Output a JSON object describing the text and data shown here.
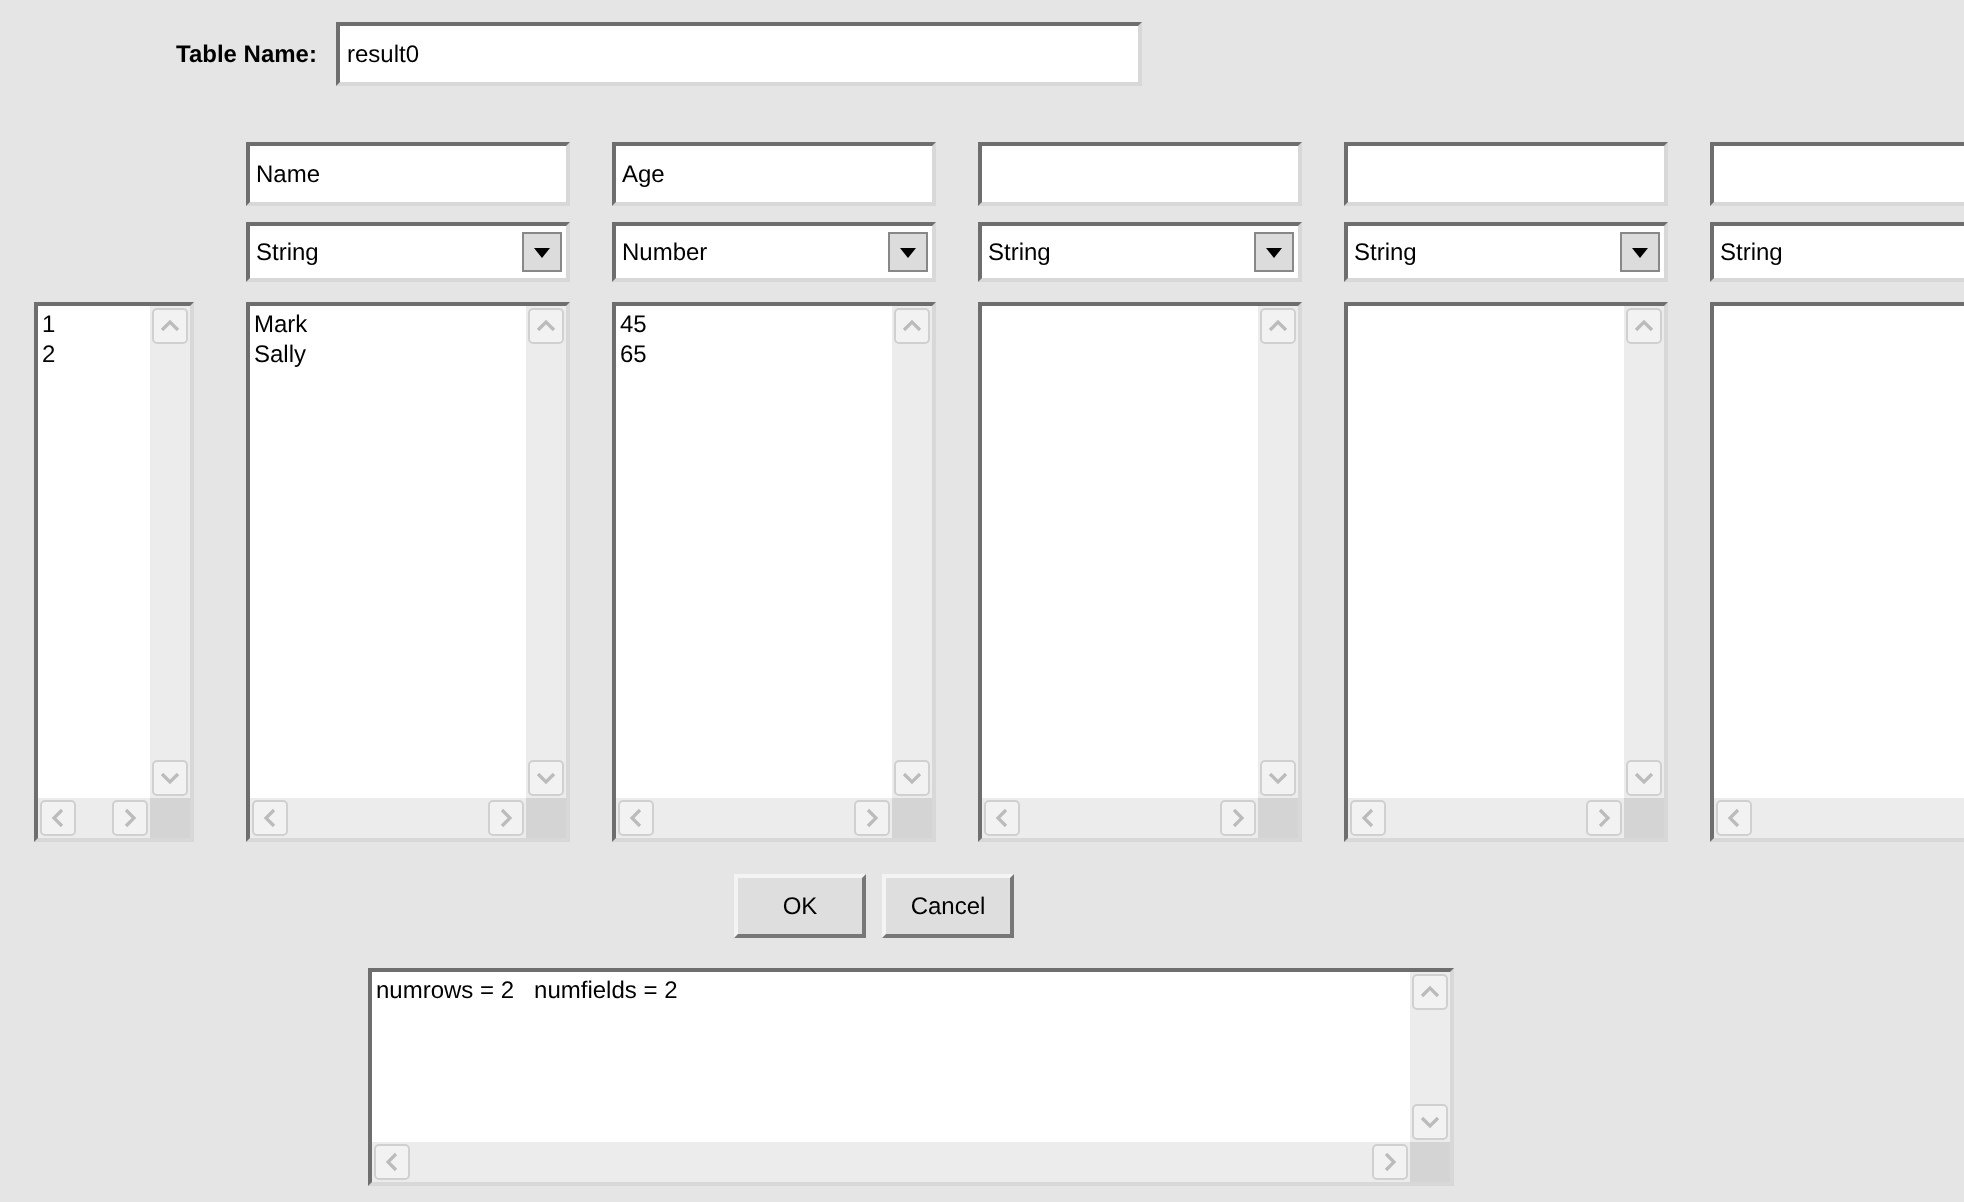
{
  "table_name": {
    "label": "Table Name:",
    "value": "result0"
  },
  "row_numbers": [
    "1",
    "2"
  ],
  "columns": [
    {
      "name": "Name",
      "type": "String",
      "values": [
        "Mark",
        "Sally"
      ]
    },
    {
      "name": "Age",
      "type": "Number",
      "values": [
        "45",
        "65"
      ]
    },
    {
      "type": "String"
    },
    {
      "type": "String"
    },
    {
      "type": "String"
    }
  ],
  "buttons": [
    "OK",
    "Cancel"
  ],
  "output": "numrows = 2   numfields = 2"
}
